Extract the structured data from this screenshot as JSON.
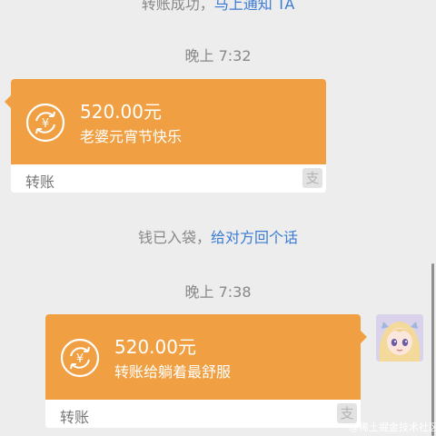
{
  "messages": {
    "top_system": {
      "text": "转账成功，",
      "link": "马上通知 TA"
    },
    "time_1": "晚上 7:32",
    "transfer_1": {
      "amount": "520.00元",
      "memo": "老婆元宵节快乐",
      "type": "转账",
      "badge": "支"
    },
    "mid_system": {
      "text": "钱已入袋，",
      "link": "给对方回个话"
    },
    "time_2": "晚上 7:38",
    "transfer_2": {
      "amount": "520.00元",
      "memo": "转账给躺着最舒服",
      "type": "转账",
      "badge": "支"
    }
  },
  "watermark": "@稀土掘金技术社区",
  "colors": {
    "transfer_orange": "#f0a042",
    "link_blue": "#3a7bd5",
    "background": "#ededed"
  },
  "icons": {
    "transfer": "yuan-transfer-icon",
    "badge": "alipay-icon"
  }
}
